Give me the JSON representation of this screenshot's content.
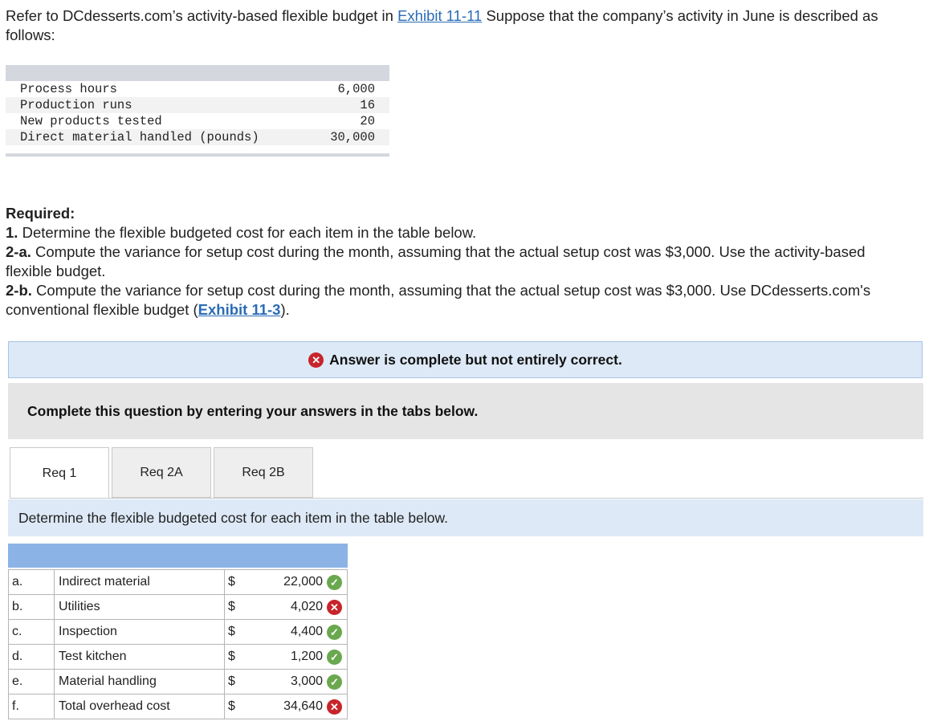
{
  "intro": {
    "text_before": "Refer to DCdesserts.com’s activity-based flexible budget in ",
    "link": "Exhibit 11-11",
    "text_after": " Suppose that the company’s activity in June is described as follows:"
  },
  "activity": [
    {
      "label": "Process hours",
      "value": "6,000"
    },
    {
      "label": "Production runs",
      "value": "16"
    },
    {
      "label": "New products tested",
      "value": "20"
    },
    {
      "label": "Direct material handled (pounds)",
      "value": "30,000"
    }
  ],
  "required": {
    "heading": "Required:",
    "items": [
      {
        "num": "1.",
        "text": " Determine the flexible budgeted cost for each item in the table below."
      },
      {
        "num": "2-a.",
        "text": " Compute the variance for setup cost during the month, assuming that the actual setup cost was $3,000. Use the activity-based flexible budget."
      },
      {
        "num": "2-b.",
        "text": " Compute the variance for setup cost during the month, assuming that the actual setup cost was $3,000. Use DCdesserts.com's conventional flexible budget (",
        "link": "Exhibit 11-3",
        "after": ")."
      }
    ]
  },
  "status_banner": "Answer is complete but not entirely correct.",
  "instruction": "Complete this question by entering your answers in the tabs below.",
  "tabs": [
    "Req 1",
    "Req 2A",
    "Req 2B"
  ],
  "tab_description": "Determine the flexible budgeted cost for each item in the table below.",
  "table_rows": [
    {
      "letter": "a.",
      "item": "Indirect material",
      "currency": "$",
      "amount": "22,000",
      "correct": true
    },
    {
      "letter": "b.",
      "item": "Utilities",
      "currency": "$",
      "amount": "4,020",
      "correct": false
    },
    {
      "letter": "c.",
      "item": "Inspection",
      "currency": "$",
      "amount": "4,400",
      "correct": true
    },
    {
      "letter": "d.",
      "item": "Test kitchen",
      "currency": "$",
      "amount": "1,200",
      "correct": true
    },
    {
      "letter": "e.",
      "item": "Material handling",
      "currency": "$",
      "amount": "3,000",
      "correct": true
    },
    {
      "letter": "f.",
      "item": "Total overhead cost",
      "currency": "$",
      "amount": "34,640",
      "correct": false
    }
  ],
  "icons": {
    "correct": "check-circle-icon",
    "incorrect": "x-circle-icon"
  },
  "colors": {
    "correct": "#6aa84f",
    "incorrect": "#c8242b",
    "header": "#8cb3e6",
    "banner": "#dde9f6"
  }
}
